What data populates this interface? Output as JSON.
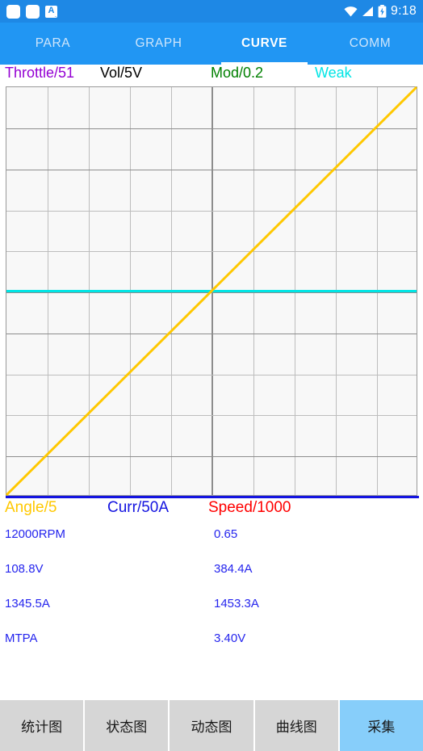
{
  "status_bar": {
    "icons_left": [
      "app-square-icon",
      "app-square-icon",
      "a-badge-icon"
    ],
    "a_badge_letter": "A",
    "a_badge_sub": "...",
    "icons_right": [
      "wifi-icon",
      "signal-icon",
      "battery-charging-icon"
    ],
    "time": "9:18",
    "background": "#1E88E5"
  },
  "tabs": {
    "items": [
      {
        "label": "PARA",
        "active": false
      },
      {
        "label": "GRAPH",
        "active": false
      },
      {
        "label": "CURVE",
        "active": true
      },
      {
        "label": "COMM",
        "active": false
      }
    ],
    "background": "#2196F3",
    "active_color": "#FFFFFF",
    "inactive_color": "#CFE6FB"
  },
  "chart_data": {
    "type": "line",
    "title": "",
    "xlabel": "",
    "ylabel": "",
    "grid": true,
    "grid_cols": 10,
    "grid_rows": 10,
    "xlim": [
      0,
      10
    ],
    "ylim": [
      0,
      10
    ],
    "legend_position": "top and bottom",
    "legend_top": [
      {
        "label": "Throttle/51",
        "color": "#9400D3"
      },
      {
        "label": "Vol/5V",
        "color": "#000000"
      },
      {
        "label": "Mod/0.2",
        "color": "#008000"
      },
      {
        "label": "Weak",
        "color": "#00E5E5"
      }
    ],
    "legend_bottom": [
      {
        "label": "Angle/5",
        "color": "#FFC800"
      },
      {
        "label": "Curr/50A",
        "color": "#1414E0"
      },
      {
        "label": "Speed/1000",
        "color": "#FF0000"
      }
    ],
    "series": [
      {
        "name": "Weak",
        "color": "#00E5E5",
        "x": [
          0,
          10
        ],
        "values": [
          5.0,
          5.0
        ]
      },
      {
        "name": "Angle/5",
        "color": "#FFC800",
        "x": [
          0,
          10
        ],
        "values": [
          0.0,
          10.0
        ]
      }
    ],
    "axis_bottom_color": "#1414E0"
  },
  "readouts": {
    "rows": [
      {
        "label": "12000RPM",
        "value": "0.65"
      },
      {
        "label": "108.8V",
        "value": "384.4A"
      },
      {
        "label": "1345.5A",
        "value": "1453.3A"
      },
      {
        "label": "MTPA",
        "value": "3.40V"
      }
    ],
    "color": "#2525EE"
  },
  "bottom_buttons": {
    "items": [
      {
        "label": "统计图",
        "accent": false
      },
      {
        "label": "状态图",
        "accent": false
      },
      {
        "label": "动态图",
        "accent": false
      },
      {
        "label": "曲线图",
        "accent": false
      },
      {
        "label": "采集",
        "accent": true
      }
    ],
    "default_background": "#D6D6D6",
    "accent_background": "#87CEFA"
  }
}
